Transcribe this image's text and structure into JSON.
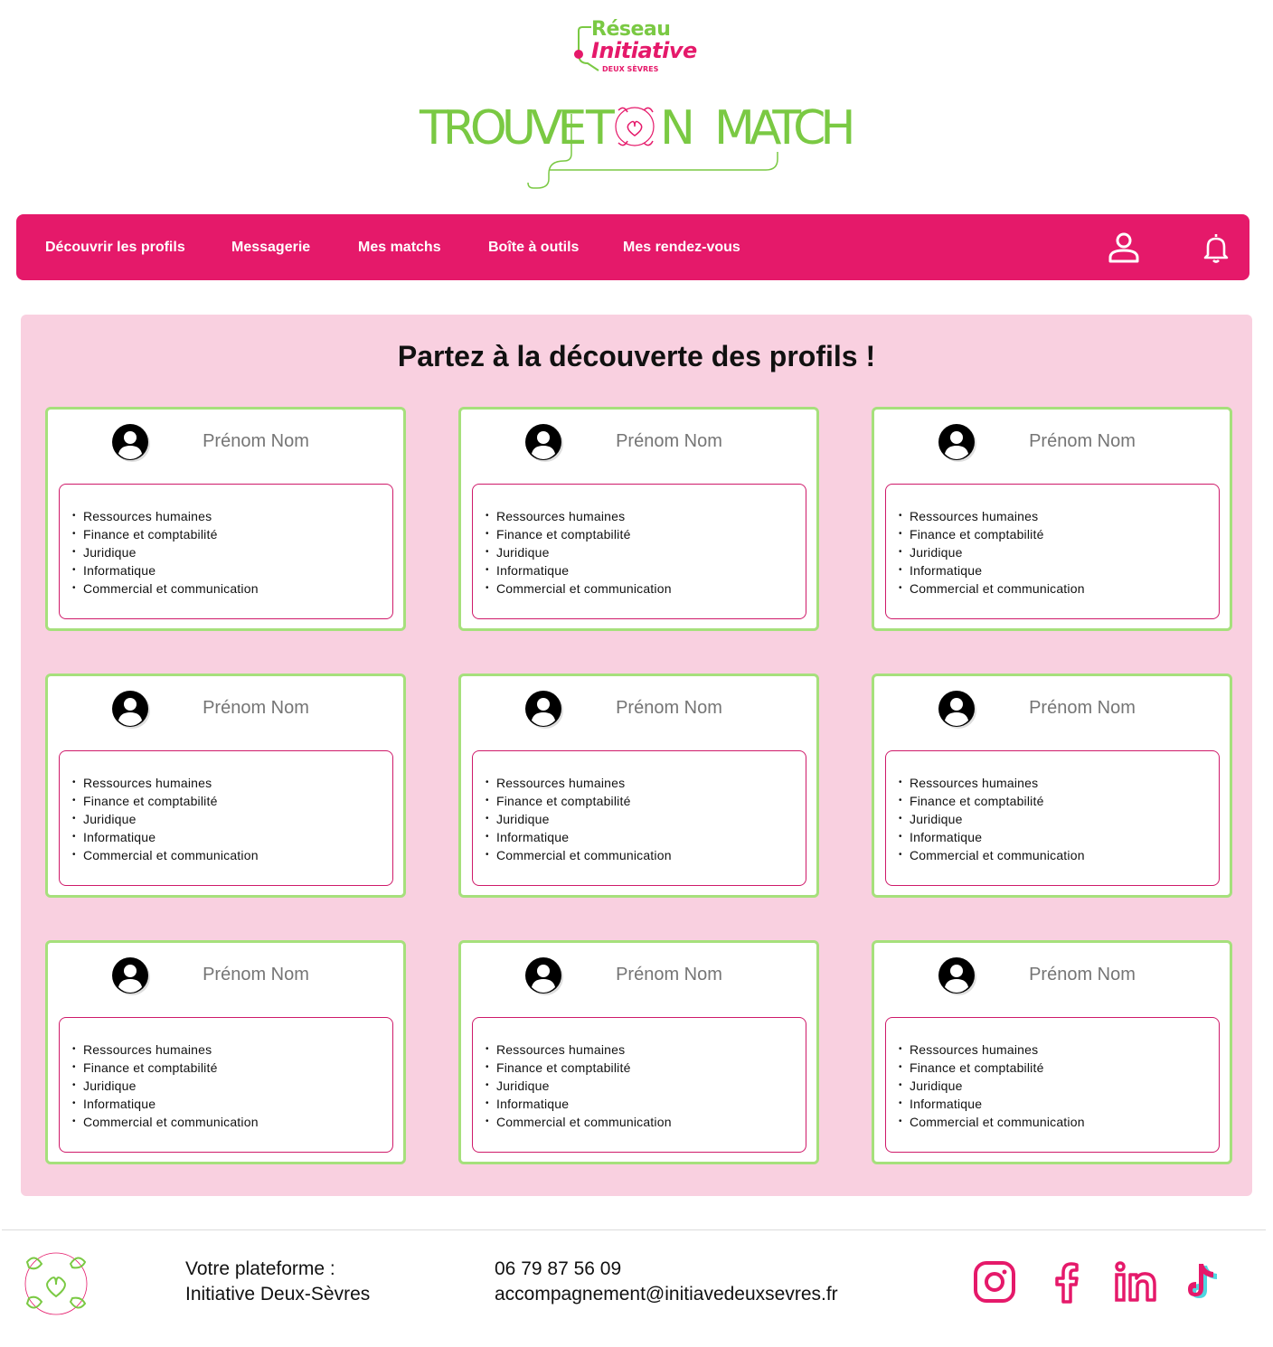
{
  "brand": {
    "reseau": "Réseau",
    "initiative": "Initiative",
    "deux_sevres": "DEUX SÈVRES"
  },
  "match_logo": {
    "word1": "TROUVE",
    "word2_t": "T",
    "word2_n": "N",
    "word3": "MATCH"
  },
  "nav": {
    "items": [
      {
        "label": "Découvrir les profils"
      },
      {
        "label": "Messagerie"
      },
      {
        "label": "Mes matchs"
      },
      {
        "label": "Boîte à outils"
      },
      {
        "label": "Mes rendez-vous"
      }
    ],
    "icons": [
      "user-icon",
      "bell-icon"
    ]
  },
  "main": {
    "title": "Partez à la découverte des profils !",
    "cards": [
      {
        "name": "Prénom Nom",
        "skills": [
          "Ressources humaines",
          "Finance et comptabilité",
          "Juridique",
          "Informatique",
          "Commercial et communication"
        ]
      },
      {
        "name": "Prénom Nom",
        "skills": [
          "Ressources humaines",
          "Finance et comptabilité",
          "Juridique",
          "Informatique",
          "Commercial et communication"
        ]
      },
      {
        "name": "Prénom Nom",
        "skills": [
          "Ressources humaines",
          "Finance et comptabilité",
          "Juridique",
          "Informatique",
          "Commercial et communication"
        ]
      },
      {
        "name": "Prénom Nom",
        "skills": [
          "Ressources humaines",
          "Finance et comptabilité",
          "Juridique",
          "Informatique",
          "Commercial et communication"
        ]
      },
      {
        "name": "Prénom Nom",
        "skills": [
          "Ressources humaines",
          "Finance et comptabilité",
          "Juridique",
          "Informatique",
          "Commercial et communication"
        ]
      },
      {
        "name": "Prénom Nom",
        "skills": [
          "Ressources humaines",
          "Finance et comptabilité",
          "Juridique",
          "Informatique",
          "Commercial et communication"
        ]
      },
      {
        "name": "Prénom Nom",
        "skills": [
          "Ressources humaines",
          "Finance et comptabilité",
          "Juridique",
          "Informatique",
          "Commercial et communication"
        ]
      },
      {
        "name": "Prénom Nom",
        "skills": [
          "Ressources humaines",
          "Finance et comptabilité",
          "Juridique",
          "Informatique",
          "Commercial et communication"
        ]
      },
      {
        "name": "Prénom Nom",
        "skills": [
          "Ressources humaines",
          "Finance et comptabilité",
          "Juridique",
          "Informatique",
          "Commercial et communication"
        ]
      }
    ]
  },
  "footer": {
    "platform_label": "Votre plateforme :",
    "platform_name": "Initiative Deux-Sèvres",
    "phone": "06 79 87 56 09",
    "email": "accompagnement@initiavedeuxsevres.fr",
    "social": [
      "instagram-icon",
      "facebook-icon",
      "linkedin-icon",
      "tiktok-icon"
    ]
  },
  "colors": {
    "brand_pink": "#e5196a",
    "brand_green": "#7ac943",
    "panel_bg": "#f9d0e0",
    "card_border": "#a6e07c"
  }
}
